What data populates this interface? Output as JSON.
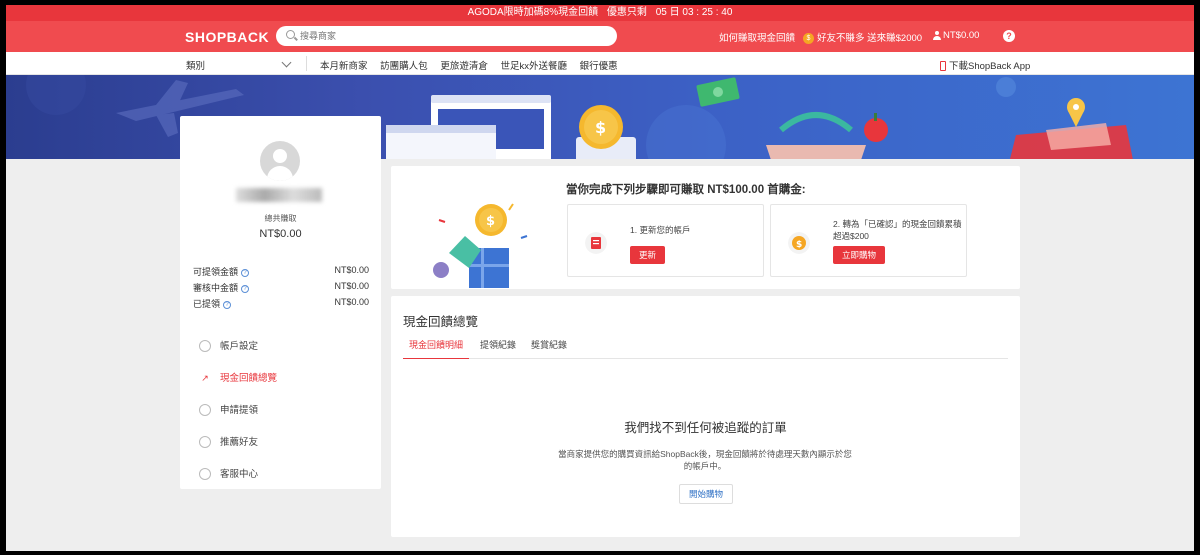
{
  "promo": {
    "text": "AGODA限時加碼8%現金回饋",
    "countdown_label": "優惠只剩",
    "countdown": "05 日 03 : 25 : 40"
  },
  "header": {
    "logo": "SHOPBACK",
    "search_placeholder": "搜尋商家",
    "how_link": "如何賺取現金回饋",
    "refer_link": "好友不賺多 送來賺$2000",
    "balance": "NT$0.00",
    "help": "?"
  },
  "nav": {
    "category": "類別",
    "items": [
      "本月新商家",
      "訪團購人包",
      "更旅遊清倉",
      "世足kx外送餐廳",
      "銀行優惠"
    ],
    "app_download": "下載ShopBack App"
  },
  "sidebar": {
    "total_label": "總共賺取",
    "total_value": "NT$0.00",
    "balances": [
      {
        "label": "可提領金額",
        "value": "NT$0.00"
      },
      {
        "label": "審核中金額",
        "value": "NT$0.00"
      },
      {
        "label": "已提領",
        "value": "NT$0.00"
      }
    ],
    "menu": [
      {
        "label": "帳戶設定"
      },
      {
        "label": "現金回饋總覽"
      },
      {
        "label": "申請提領"
      },
      {
        "label": "推薦好友"
      },
      {
        "label": "客服中心"
      }
    ]
  },
  "steps": {
    "title": "當你完成下列步驟即可賺取 NT$100.00 首購金:",
    "step1": {
      "text": "1. 更新您的帳戶",
      "button": "更新"
    },
    "step2": {
      "text": "2. 轉為「已確認」的現金回饋累積超過$200",
      "button": "立即購物"
    }
  },
  "overview": {
    "title": "現金回饋總覽",
    "tabs": [
      "現金回饋明細",
      "提領紀錄",
      "獎賞紀錄"
    ],
    "empty_title": "我們找不到任何被追蹤的訂單",
    "empty_desc": "當商家提供您的購買資訊給ShopBack後，現金回饋將於待處理天數內顯示於您的帳戶中。",
    "shop_button": "開始購物"
  },
  "colors": {
    "brand": "#f04b4f",
    "accent": "#e8363c",
    "link": "#2d6fc4"
  }
}
